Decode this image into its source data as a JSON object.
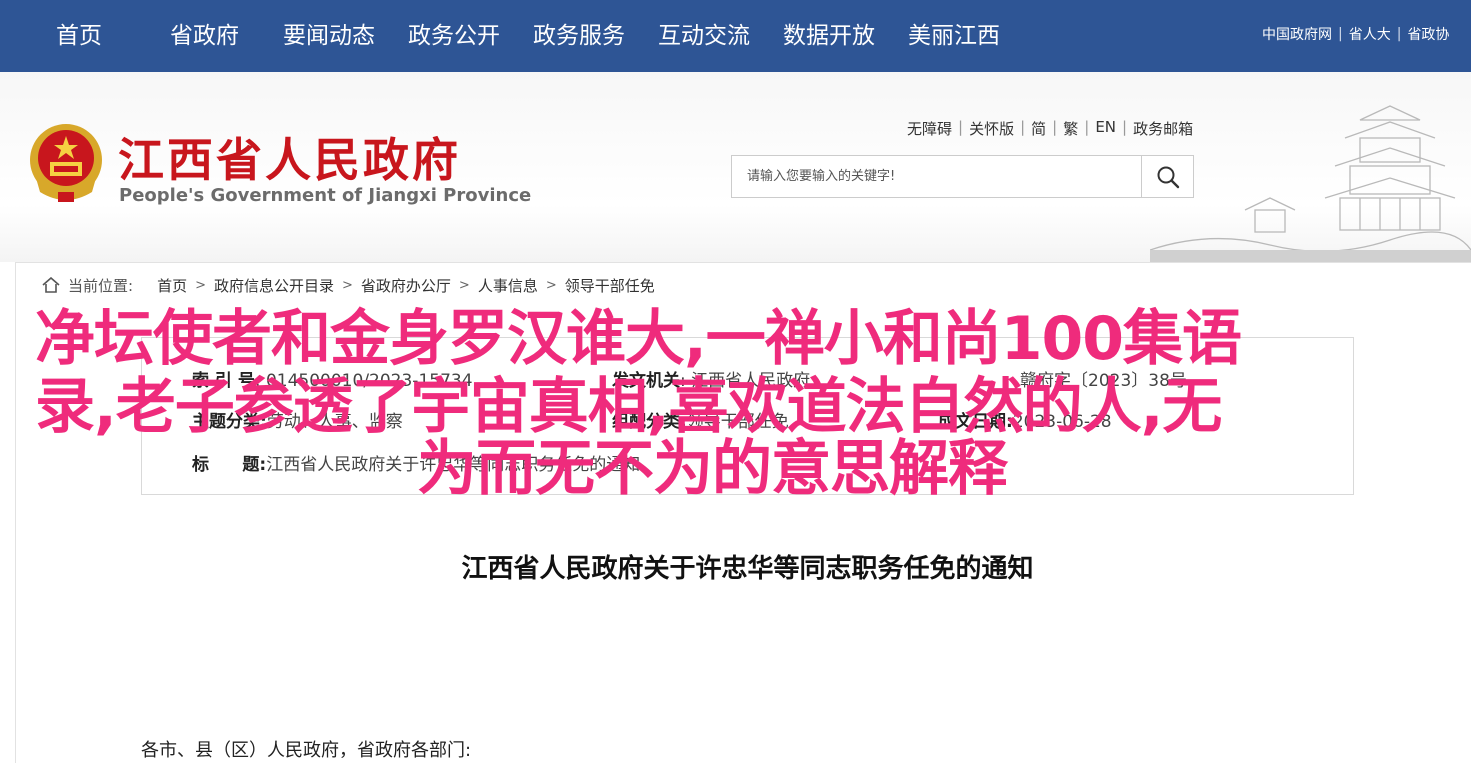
{
  "nav": {
    "items": [
      "首页",
      "省政府",
      "要闻动态",
      "政务公开",
      "政务服务",
      "互动交流",
      "数据开放",
      "美丽江西"
    ],
    "top_links": [
      "中国政府网",
      "省人大",
      "省政协"
    ]
  },
  "header": {
    "site_title": "江西省人民政府",
    "site_subtitle": "People's Government of Jiangxi Province",
    "utility_links": [
      "无障碍",
      "关怀版",
      "简",
      "繁",
      "EN",
      "政务邮箱"
    ],
    "search_placeholder": "请输入您要输入的关键字!",
    "search_icon": "search-icon"
  },
  "breadcrumb": {
    "label": "当前位置:",
    "items": [
      "首页",
      "政府信息公开目录",
      "省政府办公厅",
      "人事信息",
      "领导干部任免"
    ]
  },
  "info": {
    "index_label": "索 引 号",
    "index_value": ": 014500010/2023-15734",
    "issuer_label": "发文机关",
    "issuer_value": ": 江西省人民政府",
    "category_label": "主题分类:",
    "category_value": "劳动、人事、监察",
    "topic_label": "组配分类:",
    "topic_value": "领导干部任免",
    "docno_value": "赣府字〔2023〕38号",
    "date_label": "成文日期:",
    "date_value": "2023-06-28",
    "title_label": "标",
    "title_label2": "题:",
    "title_value": "江西省人民政府关于许忠华等同志职务任免的通知"
  },
  "document": {
    "title": "江西省人民政府关于许忠华等同志职务任免的通知",
    "salutation": "各市、县（区）人民政府，省政府各部门:"
  },
  "overlay": {
    "line1": "净坛使者和金身罗汉谁大,一禅小和尚100集语",
    "line2": "录,老子参透了宇宙真相,喜欢道法自然的人,无",
    "line3": "为而无不为的意思解释"
  },
  "colors": {
    "nav_bg": "#2e5595",
    "title_red": "#c8161d",
    "overlay_pink": "#ef2b7c"
  }
}
